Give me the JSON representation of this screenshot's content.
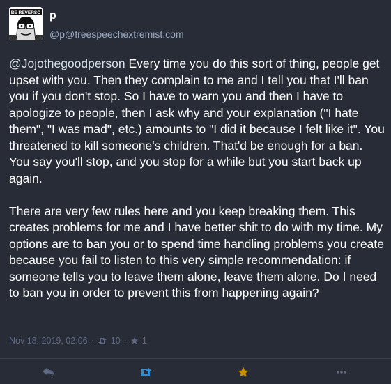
{
  "account": {
    "display_name": "p",
    "handle": "@p@freespeechextremist.com",
    "avatar_text": "BE REVERSO"
  },
  "status": {
    "mention": "@Jojothegoodperson",
    "paragraph1_rest": " Every time you do this sort of thing, people get upset with you. Then they complain to me and I tell you that I'll ban you if you don't stop. So I have to warn you and then I have to apologize to people, then I ask why and your explanation (\"I hate them\", \"I was mad\", etc.) amounts to \"I did it because I felt like it\". You threatened to kill someone's children. That'd be enough for a ban. You say you'll stop, and you stop for a while but you start back up again.",
    "paragraph2": "There are very few rules here and you keep breaking them. This creates problems for me and I have better shit to do with my time. My options are to ban you or to spend time handling problems you create because you fail to listen to this very simple recommendation: if someone tells you to leave them alone, leave them alone. Do I need to ban you in order to prevent this from happening again?"
  },
  "meta": {
    "timestamp": "Nov 18, 2019, 02:06",
    "separator": "·",
    "reblogs_count": "10",
    "favourites_count": "1"
  },
  "actions": {
    "reply_icon": "reply-all-icon",
    "boost_icon": "retweet-icon",
    "favourite_icon": "star-icon",
    "more_icon": "ellipsis-icon"
  },
  "colors": {
    "background": "#282c37",
    "text": "#ffffff",
    "muted": "#606984",
    "boost_active": "#2b90d9",
    "favourite_active": "#ca8f04"
  }
}
